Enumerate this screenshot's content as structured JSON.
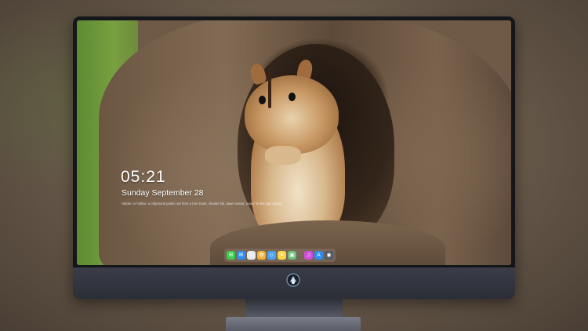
{
  "lockscreen": {
    "time": "05:21",
    "date": "Sunday September 28",
    "caption": "Hidden in hollow: a chipmunk peeks out from a tree trunk, cheeks full, paws raised, ready for the day ahead"
  },
  "dock": {
    "items": [
      {
        "name": "messages-icon",
        "color": "#3ecf4e",
        "glyph": "✉"
      },
      {
        "name": "mail-icon",
        "color": "#2f8cf0",
        "glyph": "✉"
      },
      {
        "name": "safari-icon",
        "color": "#e8e8e8",
        "glyph": "◎"
      },
      {
        "name": "photos-icon",
        "color": "#f2b233",
        "glyph": "✿"
      },
      {
        "name": "finder-icon",
        "color": "#4aa3f0",
        "glyph": "☺"
      },
      {
        "name": "notes-icon",
        "color": "#f7d64a",
        "glyph": "≡"
      },
      {
        "name": "preview-icon",
        "color": "#6cbd7a",
        "glyph": "▣"
      },
      {
        "name": "itunes-icon",
        "color": "#d04fd8",
        "glyph": "♫"
      },
      {
        "name": "app-store-icon",
        "color": "#2d8cf0",
        "glyph": "A"
      },
      {
        "name": "screenshot-icon",
        "color": "#555a66",
        "glyph": "◉"
      }
    ]
  },
  "colors": {
    "bezel": "#15161a",
    "chin": "#34363f",
    "accent": "#4aa3f0"
  }
}
